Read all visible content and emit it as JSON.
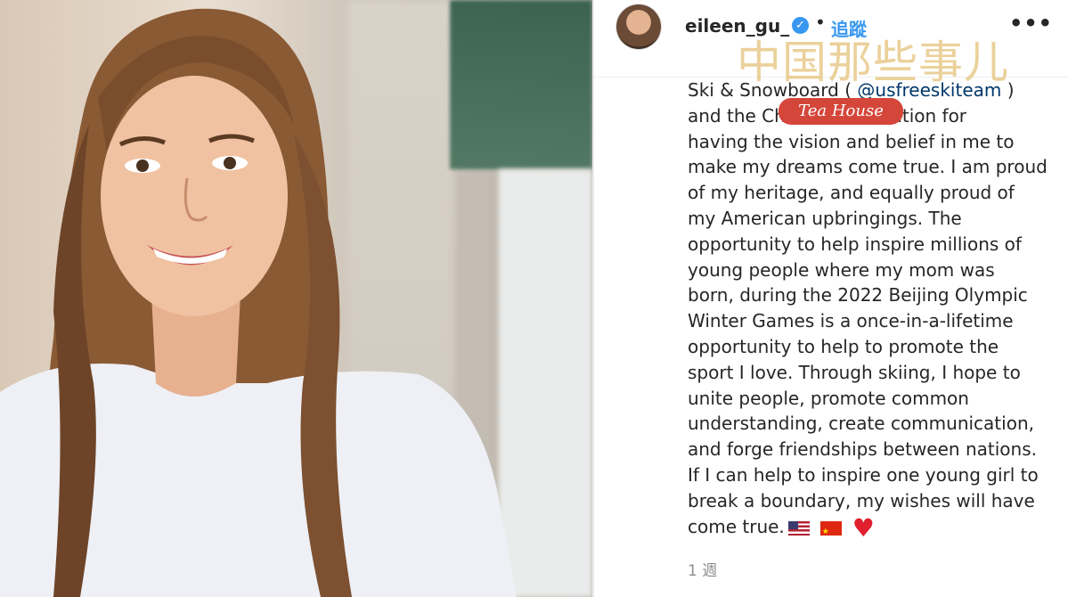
{
  "post": {
    "username": "eileen_gu_",
    "verified_icon": "verified-badge-icon",
    "separator": "•",
    "follow_label": "追蹤",
    "more_label": "•••",
    "watermark_text": "中国那些事儿",
    "watermark_badge": "Tea House",
    "caption_lines": [
      {
        "pre": "Ski & Snowboard ( ",
        "mention": "@usfreeskiteam",
        "post": " )"
      },
      {
        "pre": "and the Ch",
        "mention": "",
        "post": "ociation for"
      },
      {
        "pre": "having the vision and belief in me to",
        "mention": "",
        "post": ""
      },
      {
        "pre": "make my dreams come true. I am proud",
        "mention": "",
        "post": ""
      },
      {
        "pre": "of my heritage, and equally proud of",
        "mention": "",
        "post": ""
      },
      {
        "pre": "my American upbringings. The",
        "mention": "",
        "post": ""
      },
      {
        "pre": "opportunity to help inspire millions of",
        "mention": "",
        "post": ""
      },
      {
        "pre": "young people where my mom was",
        "mention": "",
        "post": ""
      },
      {
        "pre": "born, during the 2022 Beijing Olympic",
        "mention": "",
        "post": ""
      },
      {
        "pre": "Winter Games is a once-in-a-lifetime",
        "mention": "",
        "post": ""
      },
      {
        "pre": "opportunity to help to promote the",
        "mention": "",
        "post": ""
      },
      {
        "pre": "sport I love. Through skiing, I hope to",
        "mention": "",
        "post": ""
      },
      {
        "pre": "unite people, promote common",
        "mention": "",
        "post": ""
      },
      {
        "pre": "understanding, create communication,",
        "mention": "",
        "post": ""
      },
      {
        "pre": "and forge friendships between nations.",
        "mention": "",
        "post": ""
      },
      {
        "pre": "If I can help to inspire one young girl to",
        "mention": "",
        "post": ""
      },
      {
        "pre": "break a boundary, my wishes will have",
        "mention": "",
        "post": ""
      }
    ],
    "last_line": "come true.",
    "emojis": [
      "us-flag-icon",
      "china-flag-icon",
      "red-heart-icon"
    ],
    "timestamp": "1 週",
    "colors": {
      "link": "#3897f0",
      "mention": "#00376b",
      "text": "#262626",
      "muted": "#8e8e8e",
      "heart": "#e0202e"
    }
  }
}
